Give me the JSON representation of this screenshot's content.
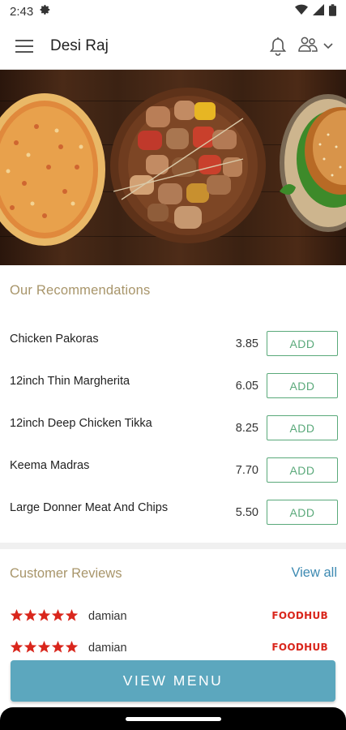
{
  "status_bar": {
    "time": "2:43",
    "icons": [
      "gear-icon",
      "wifi-icon",
      "signal-icon",
      "battery-icon"
    ]
  },
  "app_bar": {
    "title": "Desi Raj",
    "icons": [
      "hamburger-menu-icon",
      "bell-icon",
      "users-icon",
      "chevron-down-icon"
    ]
  },
  "hero": {
    "alt": "food-banner-pizza-kebab-burger"
  },
  "recommendations": {
    "title": "Our Recommendations",
    "add_label": "ADD",
    "items": [
      {
        "name": "Chicken Pakoras",
        "price": "3.85"
      },
      {
        "name": "12inch Thin Margherita",
        "price": "6.05"
      },
      {
        "name": "12inch Deep Chicken Tikka",
        "price": "8.25"
      },
      {
        "name": "Keema Madras",
        "price": "7.70"
      },
      {
        "name": "Large Donner Meat And Chips",
        "price": "5.50"
      }
    ]
  },
  "reviews": {
    "title": "Customer Reviews",
    "view_all": "View all",
    "items": [
      {
        "reviewer": "damian",
        "rating": 5,
        "source": "FOODHUB"
      },
      {
        "reviewer": "damian",
        "rating": 5,
        "source": "FOODHUB"
      }
    ]
  },
  "cta": {
    "label": "VIEW MENU"
  },
  "colors": {
    "accent_gold": "#a8956a",
    "add_green": "#5aa97a",
    "link_blue": "#3d8ab2",
    "cta_blue": "#5ca7be",
    "star_red": "#d9261c"
  }
}
